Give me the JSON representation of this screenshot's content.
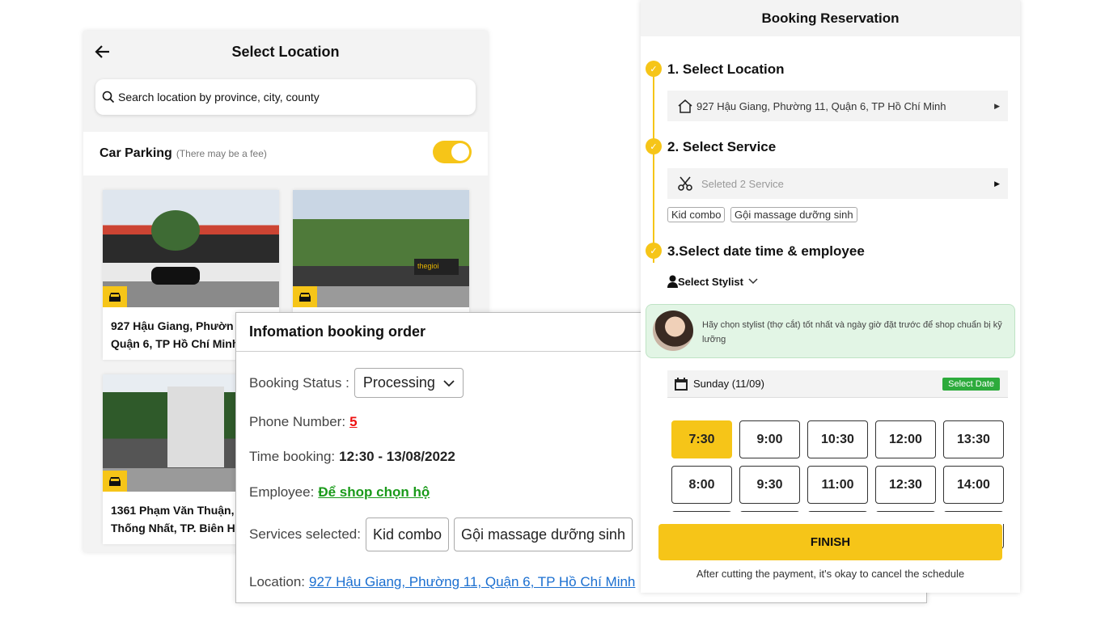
{
  "select_location": {
    "title": "Select Location",
    "search_placeholder": "Search location by province, city, county",
    "parking_label": "Car Parking",
    "parking_note": "(There may be a fee)",
    "parking_enabled": true,
    "cards": [
      {
        "address_line1": "927 Hậu Giang, Phườn",
        "address_line2": "Quận 6, TP Hồ Chí Minh"
      },
      {
        "address_line1": "",
        "address_line2": ""
      },
      {
        "address_line1": "1361 Phạm Văn Thuận,",
        "address_line2": "Thống Nhất, TP. Biên H"
      }
    ]
  },
  "booking_info": {
    "title": "Infomation booking order",
    "status_label": "Booking Status :",
    "status_value": "Processing",
    "phone_label": "Phone Number:",
    "phone_value": "5",
    "time_label": "Time booking:",
    "time_value": "12:30 - 13/08/2022",
    "employee_label": "Employee:",
    "employee_value": "Để shop chọn hộ",
    "services_label": "Services selected:",
    "services": [
      "Kid combo",
      "Gội massage dưỡng sinh"
    ],
    "location_label": "Location:",
    "location_value": "927 Hậu Giang, Phường 11, Quận 6, TP Hồ Chí Minh"
  },
  "reservation": {
    "title": "Booking Reservation",
    "step1": "1. Select Location",
    "location_value": "927 Hậu Giang, Phường 11, Quận 6, TP Hồ Chí Minh",
    "step2": "2. Select Service",
    "service_placeholder": "Seleted 2 Service",
    "service_tags": [
      "Kid combo",
      "Gội massage dưỡng sinh"
    ],
    "step3": "3.Select date time & employee",
    "stylist_label": "Select Stylist",
    "stylist_note": "Hãy chọn stylist (thợ cắt) tốt nhất và ngày giờ đặt trước để shop chuẩn bị kỹ lưỡng",
    "date_value": "Sunday (11/09)",
    "select_date_label": "Select Date",
    "times": [
      "7:30",
      "9:00",
      "10:30",
      "12:00",
      "13:30",
      "8:00",
      "9:30",
      "11:00",
      "12:30",
      "14:00"
    ],
    "selected_time": "7:30",
    "finish_label": "FINISH",
    "footer_note": "After cutting the payment, it's okay to cancel the schedule"
  },
  "colors": {
    "accent": "#f6c518",
    "green": "#2dab3c",
    "link": "#1b6fd0",
    "danger": "#e11111"
  }
}
